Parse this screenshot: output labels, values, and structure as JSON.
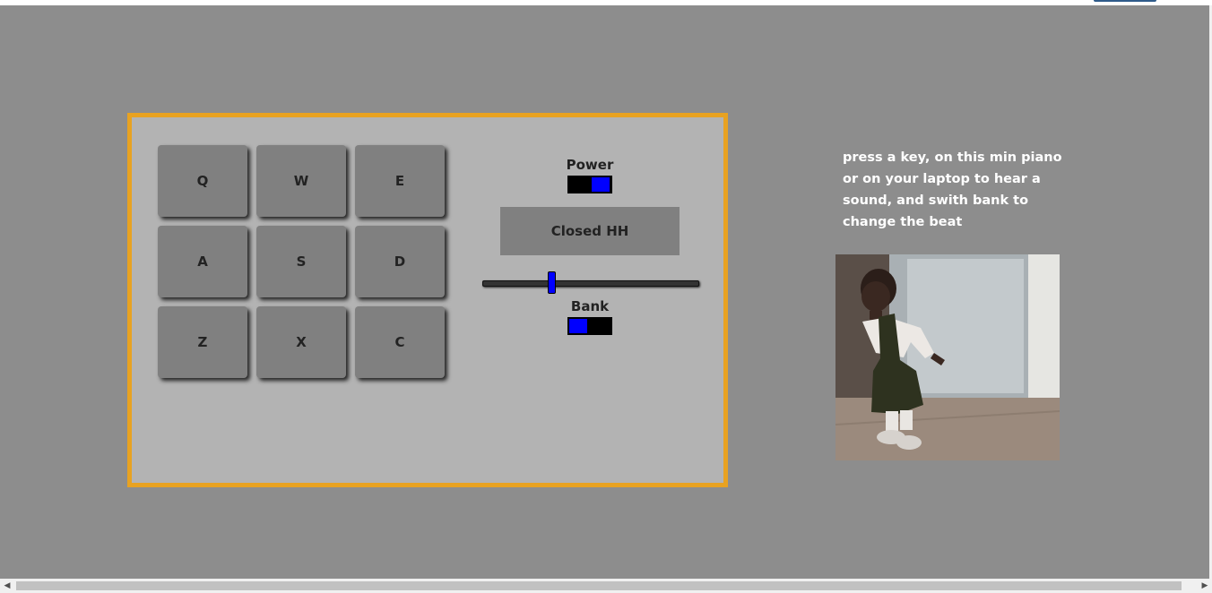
{
  "drum_pads": [
    "Q",
    "W",
    "E",
    "A",
    "S",
    "D",
    "Z",
    "X",
    "C"
  ],
  "controls": {
    "power_label": "Power",
    "power_on": true,
    "display_text": "Closed HH",
    "volume": 0.3,
    "bank_label": "Bank",
    "bank_on": false
  },
  "instructions": "press a key, on this min piano or on your laptop to hear a sound, and swith bank to change the beat",
  "colors": {
    "background": "#8d8d8d",
    "panel": "#b3b3b3",
    "border": "#e8a221",
    "pad": "#808080",
    "accent": "#0000ff"
  },
  "icons": {
    "scroll_left": "◀",
    "scroll_right": "▶"
  }
}
